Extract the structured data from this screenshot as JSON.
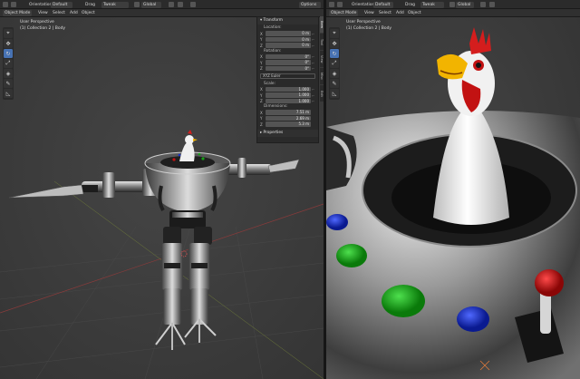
{
  "left": {
    "header": {
      "orientation_label": "Orientation",
      "orientation_value": "Default",
      "drag_label": "Drag",
      "tweak_label": "Tweak",
      "transform_space": "Global",
      "options_label": "Options"
    },
    "header2": {
      "mode": "Object Mode",
      "menus": [
        "View",
        "Select",
        "Add",
        "Object"
      ]
    },
    "view_name": "User Perspective",
    "collection_info": "(1) Collection 2 | Body"
  },
  "npanel": {
    "transform_title": "Transform",
    "location_label": "Location:",
    "location": [
      [
        "X",
        "0 m"
      ],
      [
        "Y",
        "0 m"
      ],
      [
        "Z",
        "0 m"
      ]
    ],
    "rotation_label": "Rotation:",
    "rotation": [
      [
        "X",
        "0°"
      ],
      [
        "Y",
        "0°"
      ],
      [
        "Z",
        "0°"
      ]
    ],
    "rotation_mode": "XYZ Euler",
    "scale_label": "Scale:",
    "scale": [
      [
        "X",
        "1.000"
      ],
      [
        "Y",
        "1.000"
      ],
      [
        "Z",
        "1.000"
      ]
    ],
    "dimensions_label": "Dimensions:",
    "dimensions": [
      [
        "X",
        "7.51 m"
      ],
      [
        "Y",
        "2.69 m"
      ],
      [
        "Z",
        "5.3 m"
      ]
    ],
    "properties_title": "Properties",
    "tabs": [
      "Item",
      "Tool",
      "View",
      "Misc",
      "Edit"
    ]
  },
  "right": {
    "header": {
      "orientation_label": "Orientation",
      "orientation_value": "Default",
      "drag_label": "Drag",
      "tweak_label": "Tweak",
      "transform_space": "Global"
    },
    "header2": {
      "mode": "Object Mode",
      "menus": [
        "View",
        "Select",
        "Add",
        "Object"
      ]
    },
    "view_name": "User Perspective",
    "collection_info": "(1) Collection 2 | Body"
  },
  "colors": {
    "active_tool": "#4772b3",
    "button_red": "#c21212",
    "button_green": "#16a016",
    "button_blue": "#1c34c8",
    "chicken_comb": "#d41d1d",
    "beak": "#f2b400"
  },
  "icons": [
    "cursor-tool-icon",
    "move-tool-icon",
    "rotate-tool-icon",
    "scale-tool-icon",
    "transform-tool-icon",
    "annotate-tool-icon",
    "measure-tool-icon",
    "3d-cursor-icon"
  ]
}
